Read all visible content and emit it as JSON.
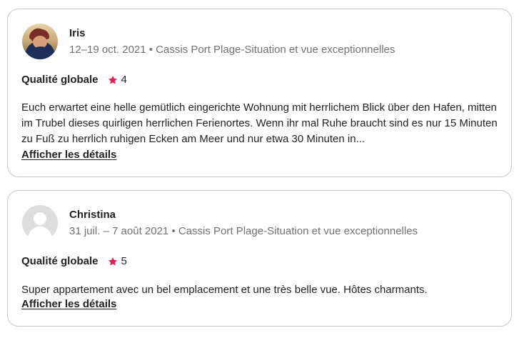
{
  "reviews": [
    {
      "name": "Iris",
      "meta": "12–19 oct. 2021 • Cassis Port Plage-Situation et vue exceptionnelles",
      "avatar": "photo",
      "rating_label": "Qualité globale",
      "rating_value": "4",
      "text": "Euch erwartet eine helle gemütlich eingerichte Wohnung mit herrlichem Blick über den Hafen, mitten im Trubel dieses quirligen herrlichen Ferienortes. Wenn ihr mal Ruhe braucht sind es nur 15 Minuten zu Fuß zu herrlich ruhigen Ecken am Meer und nur etwa 30 Minuten in...",
      "details_label": "Afficher les détails"
    },
    {
      "name": "Christina",
      "meta": "31 juil. – 7 août 2021 • Cassis Port Plage-Situation et vue exceptionnelles",
      "avatar": "default",
      "rating_label": "Qualité globale",
      "rating_value": "5",
      "text": "Super appartement avec un bel emplacement et une très belle vue. Hôtes charmants.",
      "details_label": "Afficher les détails"
    }
  ],
  "colors": {
    "star": "#e51d53",
    "meta_text": "#717171",
    "border": "#c8c8c8"
  },
  "icons": {
    "rating": "star-icon"
  }
}
